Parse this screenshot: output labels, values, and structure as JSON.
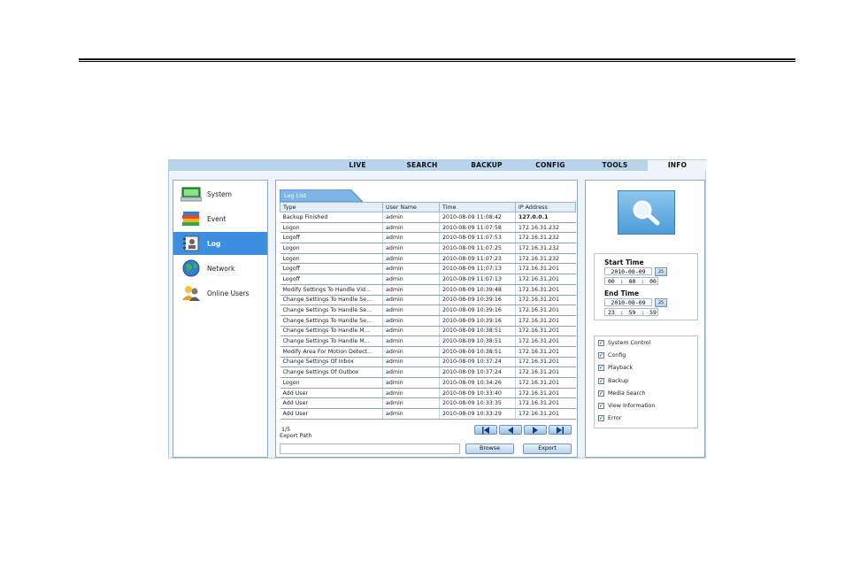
{
  "nav": {
    "tabs": [
      "LIVE",
      "SEARCH",
      "BACKUP",
      "CONFIG",
      "TOOLS",
      "INFO"
    ],
    "active": "INFO"
  },
  "sidebar": {
    "items": [
      {
        "label": "System",
        "icon": "system-icon",
        "active": false
      },
      {
        "label": "Event",
        "icon": "event-icon",
        "active": false
      },
      {
        "label": "Log",
        "icon": "log-icon",
        "active": true
      },
      {
        "label": "Network",
        "icon": "network-icon",
        "active": false
      },
      {
        "label": "Online Users",
        "icon": "online-users-icon",
        "active": false
      }
    ]
  },
  "log": {
    "tab_label": "Log List",
    "columns": [
      "Type",
      "User Name",
      "Time",
      "IP Address"
    ],
    "rows": [
      [
        "Backup Finished",
        "admin",
        "2010-08-09 11:08:42",
        "127.0.0.1"
      ],
      [
        "Logon",
        "admin",
        "2010-08-09 11:07:58",
        "172.16.31.232"
      ],
      [
        "Logoff",
        "admin",
        "2010-08-09 11:07:53",
        "172.16.31.232"
      ],
      [
        "Logon",
        "admin",
        "2010-08-09 11:07:25",
        "172.16.31.232"
      ],
      [
        "Logon",
        "admin",
        "2010-08-09 11:07:23",
        "172.16.31.232"
      ],
      [
        "Logoff",
        "admin",
        "2010-08-09 11:07:13",
        "172.16.31.201"
      ],
      [
        "Logoff",
        "admin",
        "2010-08-09 11:07:13",
        "172.16.31.201"
      ],
      [
        "Modify Settings To Handle Vid...",
        "admin",
        "2010-08-09 10:39:48",
        "172.16.31.201"
      ],
      [
        "Change Settings To Handle Se...",
        "admin",
        "2010-08-09 10:39:16",
        "172.16.31.201"
      ],
      [
        "Change Settings To Handle Se...",
        "admin",
        "2010-08-09 10:39:16",
        "172.16.31.201"
      ],
      [
        "Change Settings To Handle Se...",
        "admin",
        "2010-08-09 10:39:16",
        "172.16.31.201"
      ],
      [
        "Change Settings To Handle M...",
        "admin",
        "2010-08-09 10:38:51",
        "172.16.31.201"
      ],
      [
        "Change Settings To Handle M...",
        "admin",
        "2010-08-09 10:38:51",
        "172.16.31.201"
      ],
      [
        "Modify Area For Motion Detect...",
        "admin",
        "2010-08-09 10:38:51",
        "172.16.31.201"
      ],
      [
        "Change Settings Of Inbox",
        "admin",
        "2010-08-09 10:37:24",
        "172.16.31.201"
      ],
      [
        "Change Settings Of Outbox",
        "admin",
        "2010-08-09 10:37:24",
        "172.16.31.201"
      ],
      [
        "Logon",
        "admin",
        "2010-08-09 10:34:26",
        "172.16.31.201"
      ],
      [
        "Add User",
        "admin",
        "2010-08-09 10:33:40",
        "172.16.31.201"
      ],
      [
        "Add User",
        "admin",
        "2010-08-09 10:33:35",
        "172.16.31.201"
      ],
      [
        "Add User",
        "admin",
        "2010-08-09 10:33:29",
        "172.16.31.201"
      ]
    ],
    "page": "1/5",
    "export_path_label": "Export Path",
    "export_path_value": "",
    "browse_label": "Browse",
    "export_label": "Export"
  },
  "filter": {
    "search_icon": "magnifier-icon",
    "start_time_label": "Start Time",
    "start_date": "2010-08-09",
    "start_time": "00 : 00 : 00",
    "end_time_label": "End Time",
    "end_date": "2010-08-09",
    "end_time": "23 : 59 : 59",
    "calendar_label": "25",
    "checks": [
      {
        "label": "System Control",
        "checked": true
      },
      {
        "label": "Config",
        "checked": true
      },
      {
        "label": "Playback",
        "checked": true
      },
      {
        "label": "Backup",
        "checked": true
      },
      {
        "label": "Media Search",
        "checked": true
      },
      {
        "label": "View Information",
        "checked": true
      },
      {
        "label": "Error",
        "checked": true
      }
    ]
  },
  "colors": {
    "accent": "#3c8fe0",
    "nav_bar": "#b7d4ec",
    "panel_bg": "#eef4fa",
    "border": "#8fa9c2"
  }
}
